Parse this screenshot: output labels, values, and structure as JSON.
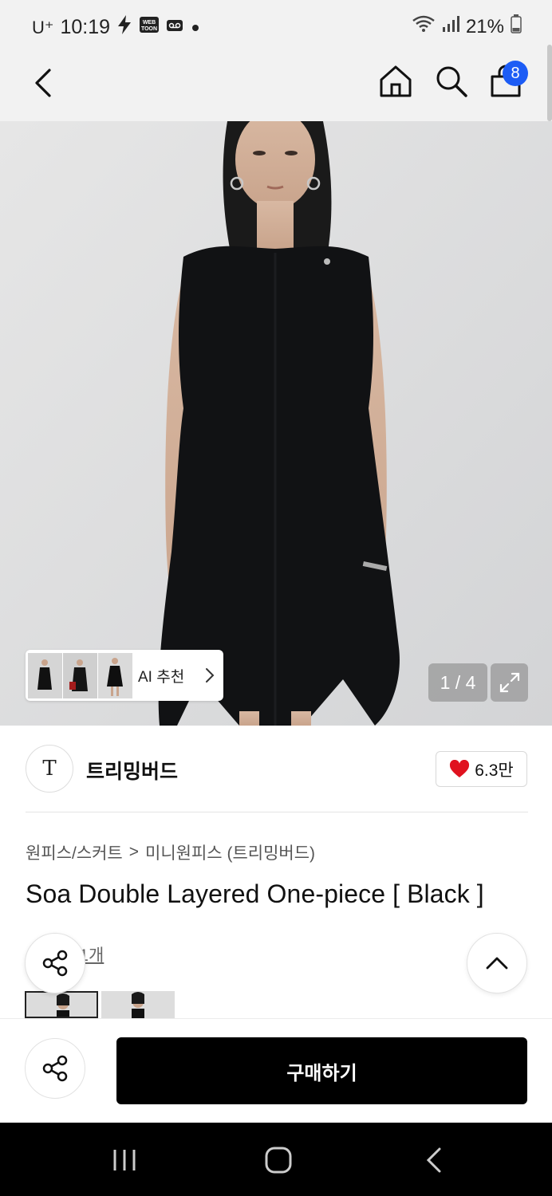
{
  "status_bar": {
    "carrier": "U⁺",
    "time": "10:19",
    "webtoon_badge": "WEB TOON",
    "battery": "21%"
  },
  "nav": {
    "cart_count": "8"
  },
  "hero": {
    "ai_recommend_label": "AI 추천",
    "page_counter": "1 / 4"
  },
  "brand": {
    "logo_letter": "T",
    "name": "트리밍버드",
    "likes": "6.3만"
  },
  "product": {
    "breadcrumb": [
      "원피스/스커트",
      ">",
      "미니원피스 (트리밍버드)"
    ],
    "title": "Soa Double Layered One-piece [ Black ]",
    "review_text": "후기 1개"
  },
  "actions": {
    "buy_label": "구매하기"
  }
}
